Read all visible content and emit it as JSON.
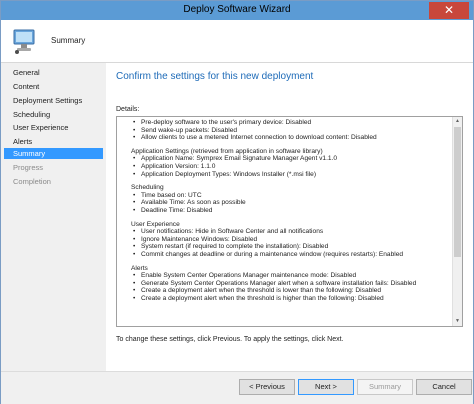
{
  "window": {
    "title": "Deploy Software Wizard",
    "close_glyph": "✕"
  },
  "header": {
    "page_name": "Summary",
    "icon": "computer-wizard-icon"
  },
  "sidebar": {
    "items": [
      {
        "label": "General",
        "state": "normal"
      },
      {
        "label": "Content",
        "state": "normal"
      },
      {
        "label": "Deployment Settings",
        "state": "normal"
      },
      {
        "label": "Scheduling",
        "state": "normal"
      },
      {
        "label": "User Experience",
        "state": "normal"
      },
      {
        "label": "Alerts",
        "state": "normal"
      },
      {
        "label": "Summary",
        "state": "active"
      },
      {
        "label": "Progress",
        "state": "disabled"
      },
      {
        "label": "Completion",
        "state": "disabled"
      }
    ]
  },
  "main": {
    "title": "Confirm the settings for this new deployment",
    "details_label": "Details:",
    "details_lines": [
      {
        "text": "Pre-deploy software to the user's primary device: Disabled",
        "bullet": true
      },
      {
        "text": "Send wake-up packets: Disabled",
        "bullet": true
      },
      {
        "text": "Allow clients to use a metered Internet connection to download content: Disabled",
        "bullet": true
      },
      {
        "text": "",
        "bullet": false,
        "gap": true
      },
      {
        "text": "Application Settings (retrieved from application in software library)",
        "bullet": false
      },
      {
        "text": "Application Name: Symprex Email Signature Manager Agent v1.1.0",
        "bullet": true
      },
      {
        "text": "Application Version: 1.1.0",
        "bullet": true
      },
      {
        "text": "Application Deployment Types: Windows Installer (*.msi file)",
        "bullet": true
      },
      {
        "text": "",
        "bullet": false,
        "gap": true
      },
      {
        "text": "Scheduling",
        "bullet": false
      },
      {
        "text": "Time based on: UTC",
        "bullet": true
      },
      {
        "text": "Available Time: As soon as possible",
        "bullet": true
      },
      {
        "text": "Deadline Time: Disabled",
        "bullet": true
      },
      {
        "text": "",
        "bullet": false,
        "gap": true
      },
      {
        "text": "User Experience",
        "bullet": false
      },
      {
        "text": "User notifications: Hide in Software Center and all notifications",
        "bullet": true
      },
      {
        "text": "Ignore Maintenance Windows: Disabled",
        "bullet": true
      },
      {
        "text": "System restart  (if required to complete the installation): Disabled",
        "bullet": true
      },
      {
        "text": "Commit changes at deadline or during a maintenance window (requires restarts): Enabled",
        "bullet": true
      },
      {
        "text": "",
        "bullet": false,
        "gap": true
      },
      {
        "text": "Alerts",
        "bullet": false
      },
      {
        "text": "Enable System Center Operations Manager maintenance mode: Disabled",
        "bullet": true
      },
      {
        "text": "Generate System Center Operations Manager alert when a software installation fails: Disabled",
        "bullet": true
      },
      {
        "text": "Create a deployment alert when the threshold is lower than the following: Disabled",
        "bullet": true
      },
      {
        "text": "Create a deployment alert when the threshold is higher than the following: Disabled",
        "bullet": true
      }
    ],
    "footnote": "To change these settings, click Previous. To apply the settings, click Next."
  },
  "footer": {
    "previous_label": "< Previous",
    "next_label": "Next >",
    "summary_label": "Summary",
    "cancel_label": "Cancel"
  }
}
